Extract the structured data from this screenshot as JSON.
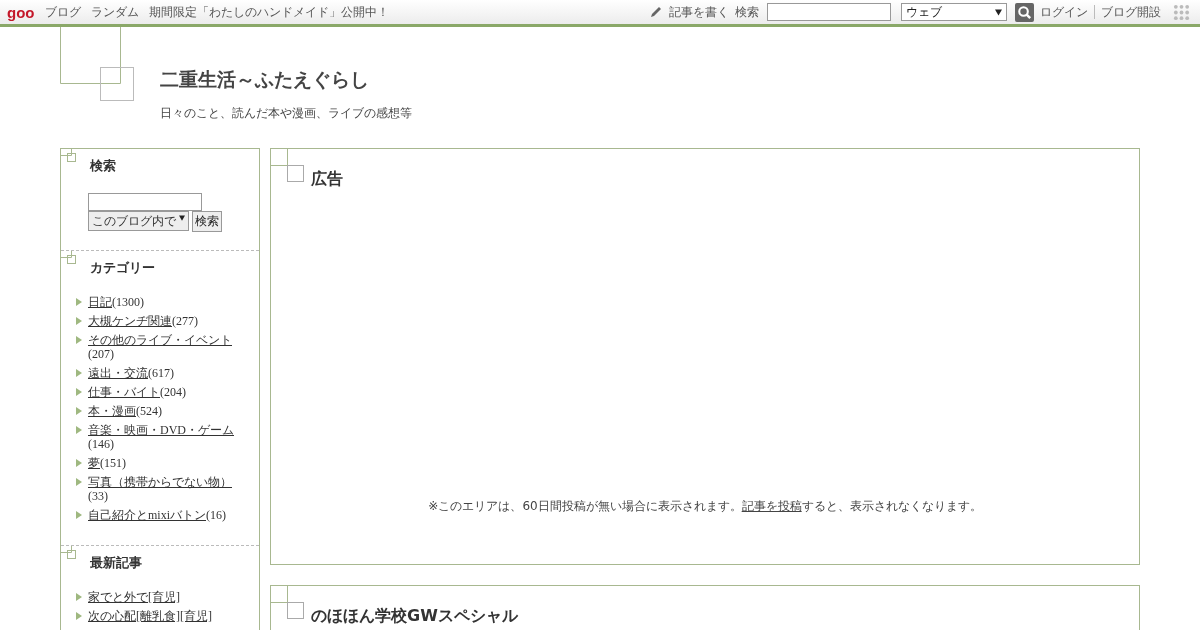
{
  "topbar": {
    "logo": "goo",
    "links": [
      "ブログ",
      "ランダム",
      "期間限定「わたしのハンドメイド」公開中！"
    ],
    "write": "記事を書く",
    "search_label": "検索",
    "search_scope": "ウェブ",
    "login": "ログイン",
    "open_blog": "ブログ開設"
  },
  "blog": {
    "title": "二重生活～ふたえぐらし",
    "subtitle": "日々のこと、読んだ本や漫画、ライブの感想等"
  },
  "sidebar": {
    "search": {
      "heading": "検索",
      "scope": "このブログ内で",
      "button": "検索"
    },
    "categories": {
      "heading": "カテゴリー",
      "items": [
        {
          "name": "日記",
          "count": "(1300)"
        },
        {
          "name": "大槻ケンヂ関連",
          "count": "(277)"
        },
        {
          "name": "その他のライブ・イベント",
          "count": "(207)"
        },
        {
          "name": "遠出・交流",
          "count": "(617)"
        },
        {
          "name": "仕事・バイト",
          "count": "(204)"
        },
        {
          "name": "本・漫画",
          "count": "(524)"
        },
        {
          "name": "音楽・映画・DVD・ゲーム",
          "count": "(146)"
        },
        {
          "name": "夢",
          "count": "(151)"
        },
        {
          "name": "写真（携帯からでない物）",
          "count": "(33)"
        },
        {
          "name": "自己紹介とmixiバトン",
          "count": "(16)"
        }
      ]
    },
    "recent": {
      "heading": "最新記事",
      "items": [
        "家でと外で[育児]",
        "次の心配[離乳食][育児]"
      ]
    }
  },
  "ad": {
    "heading": "広告",
    "notice_before": "※このエリアは、60日間投稿が無い場合に表示されます。",
    "notice_link": "記事を投稿",
    "notice_after": "すると、表示されなくなります。"
  },
  "post": {
    "title": "のほほん学校GWスペシャル"
  }
}
